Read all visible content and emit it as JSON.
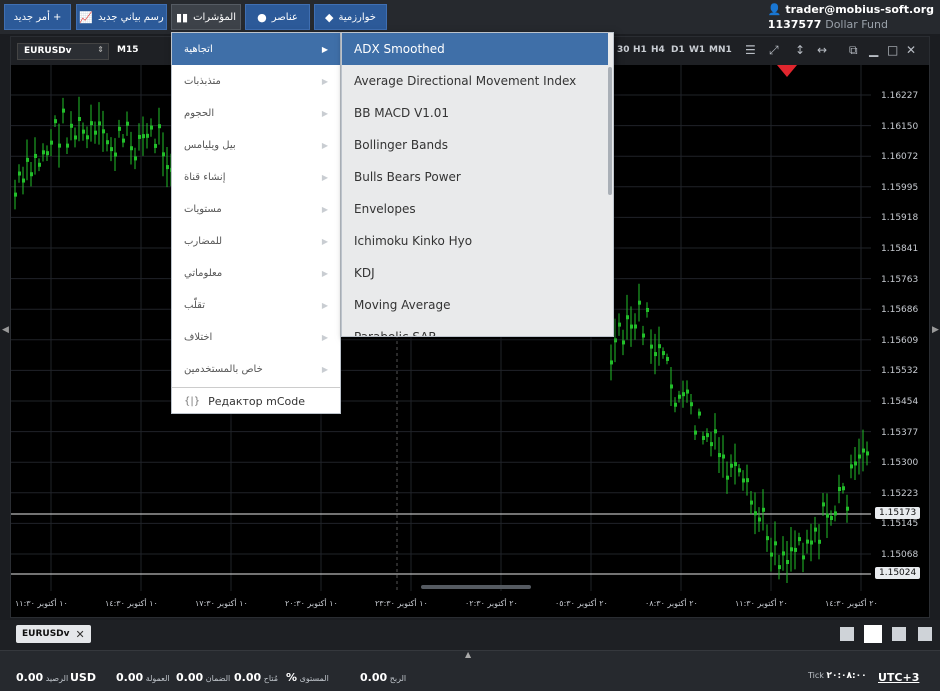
{
  "toolbar": {
    "new_order": "أمر جديد +",
    "new_chart": "رسم بياني جديد",
    "indicators": "المؤشرات",
    "elements": "عناصر",
    "algorithmic": "خوارزمية"
  },
  "account": {
    "email": "trader@mobius-soft.org",
    "number": "1137577",
    "fund": "Dollar Fund"
  },
  "chart": {
    "symbol": "EURUSDv",
    "timeframe": "M15",
    "timeframes": [
      "30",
      "H1",
      "H4",
      "D1",
      "W1",
      "MN1"
    ],
    "price_labels": [
      "1.16227",
      "1.16150",
      "1.16072",
      "1.15995",
      "1.15918",
      "1.15841",
      "1.15763",
      "1.15686",
      "1.15609",
      "1.15532",
      "1.15454",
      "1.15377",
      "1.15300",
      "1.15223",
      "1.15145",
      "1.15068"
    ],
    "level_labels": [
      "1.15173",
      "1.15024"
    ],
    "time_labels": [
      "١٠ أكتوبر ١١:٣٠",
      "١٠ أكتوبر ١٤:٣٠",
      "١٠ أكتوبر ١٧:٣٠",
      "١٠ أكتوبر ٢٠:٣٠",
      "١٠ أكتوبر ٢٣:٣٠",
      "٢٠ أكتوبر ٠٢:٣٠",
      "٢٠ أكتوبر ٠٥:٣٠",
      "٢٠ أكتوبر ٠٨:٣٠",
      "٢٠ أكتوبر ١١:٣٠",
      "٢٠ أكتوبر ١٤:٣٠"
    ],
    "accent_green": "#22c02a",
    "marker_red": "#e0262e"
  },
  "indicator_menu": {
    "categories": [
      "اتجاهية",
      "متذبذبات",
      "الحجوم",
      "بيل ويليامس",
      "إنشاء قناة",
      "مستويات",
      "للمضارب",
      "معلوماتي",
      "تقلّب",
      "اختلاف",
      "خاص بالمستخدمين"
    ],
    "selected_category": "اتجاهية",
    "mcode_label": "Редактор mCode",
    "trend_items": [
      "ADX Smoothed",
      "Average Directional Movement Index",
      "BB MACD V1.01",
      "Bollinger Bands",
      "Bulls Bears Power",
      "Envelopes",
      "Ichimoku Kinko Hyo",
      "KDJ",
      "Moving Average",
      "Parabolic SAR"
    ],
    "highlighted_item": "ADX Smoothed"
  },
  "tabs": {
    "open": [
      "EURUSDv"
    ]
  },
  "status": {
    "balance_label": "الرصيد",
    "balance_value": "0.00",
    "currency": "USD",
    "commission_label": "العمولة",
    "commission_value": "0.00",
    "margin_label": "الضمان",
    "margin_value": "0.00",
    "free_label": "مُتاح",
    "free_value": "0.00",
    "level_label": "المستوى",
    "level_value": "%",
    "profit_label": "الربح",
    "profit_value": "0.00",
    "tick_label": "Tick",
    "tick_value": "٢٠:٠٨:٠٠",
    "timezone": "UTC+3"
  }
}
